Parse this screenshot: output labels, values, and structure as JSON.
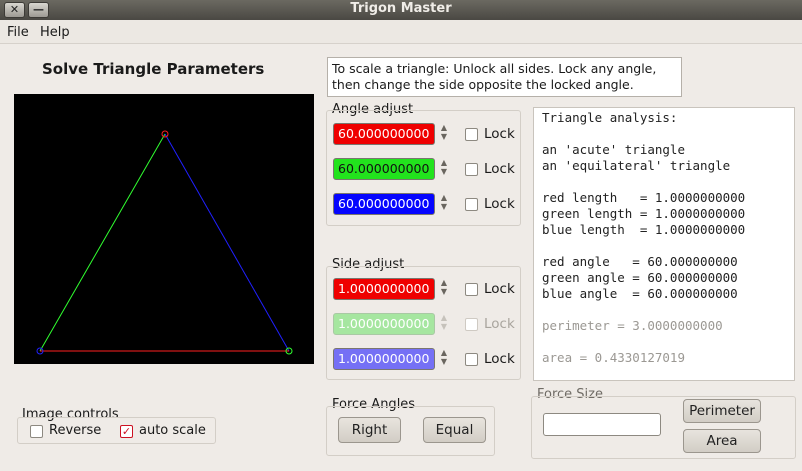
{
  "window": {
    "title": "Trigon Master",
    "close_glyph": "✕",
    "min_glyph": "—"
  },
  "menu": {
    "file": "File",
    "help": "Help"
  },
  "solve_title": "Solve Triangle Parameters",
  "info_text": "To scale a triangle:  Unlock all sides. Lock any angle, then change the side opposite the locked angle.",
  "angle_adjust": {
    "label": "Angle adjust",
    "rows": [
      {
        "value": "60.000000000",
        "color": "#ef0000",
        "lock": "Lock"
      },
      {
        "value": "60.000000000",
        "color": "#22e31d",
        "lock": "Lock"
      },
      {
        "value": "60.000000000",
        "color": "#0505ff",
        "lock": "Lock"
      }
    ]
  },
  "side_adjust": {
    "label": "Side adjust",
    "rows": [
      {
        "value": "1.0000000000",
        "lock": "Lock"
      },
      {
        "value": "1.0000000000",
        "lock": "Lock"
      },
      {
        "value": "1.0000000000",
        "lock": "Lock"
      }
    ]
  },
  "analysis_lines": [
    "Triangle analysis:",
    "",
    "an 'acute' triangle",
    "an 'equilateral' triangle",
    "",
    "red length   = 1.0000000000",
    "green length = 1.0000000000",
    "blue length  = 1.0000000000",
    "",
    "red angle   = 60.000000000",
    "green angle = 60.000000000",
    "blue angle  = 60.000000000",
    "",
    "perimeter = 3.0000000000",
    "",
    "area = 0.4330127019"
  ],
  "image_controls": {
    "label": "Image controls",
    "reverse": "Reverse",
    "auto_scale": "auto scale",
    "auto_scale_checked": true,
    "check_glyph": "✓"
  },
  "force_angles": {
    "label": "Force Angles",
    "right": "Right",
    "equal": "Equal"
  },
  "force_size": {
    "label": "Force Size",
    "perimeter": "Perimeter",
    "area": "Area",
    "input_value": ""
  },
  "arrows": {
    "up": "▲",
    "down": "▼"
  },
  "colors": {
    "red": "#ff2020",
    "green": "#30ff30",
    "blue": "#2020ff"
  }
}
